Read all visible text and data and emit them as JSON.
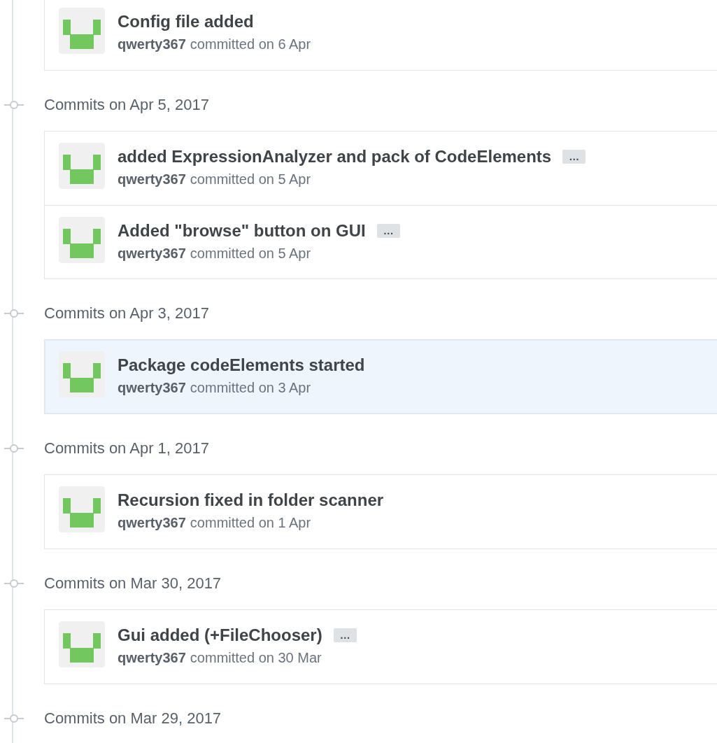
{
  "groups": [
    {
      "commits": [
        {
          "title": "Config file added",
          "author": "qwerty367",
          "meta": "committed on 6 Apr",
          "highlighted": false
        }
      ]
    },
    {
      "heading": "Commits on Apr 5, 2017",
      "commits": [
        {
          "title": "added ExpressionAnalyzer and pack of CodeElements",
          "ellipsis": "…",
          "author": "qwerty367",
          "meta": "committed on 5 Apr",
          "highlighted": false
        },
        {
          "title": "Added \"browse\" button on GUI",
          "ellipsis": "…",
          "author": "qwerty367",
          "meta": "committed on 5 Apr",
          "highlighted": false
        }
      ]
    },
    {
      "heading": "Commits on Apr 3, 2017",
      "commits": [
        {
          "title": "Package codeElements started",
          "author": "qwerty367",
          "meta": "committed on 3 Apr",
          "highlighted": true
        }
      ]
    },
    {
      "heading": "Commits on Apr 1, 2017",
      "commits": [
        {
          "title": "Recursion fixed in folder scanner",
          "author": "qwerty367",
          "meta": "committed on 1 Apr",
          "highlighted": false
        }
      ]
    },
    {
      "heading": "Commits on Mar 30, 2017",
      "commits": [
        {
          "title": "Gui added (+FileChooser)",
          "ellipsis": "…",
          "author": "qwerty367",
          "meta": "committed on 30 Mar",
          "highlighted": false
        }
      ]
    },
    {
      "heading": "Commits on Mar 29, 2017"
    }
  ]
}
